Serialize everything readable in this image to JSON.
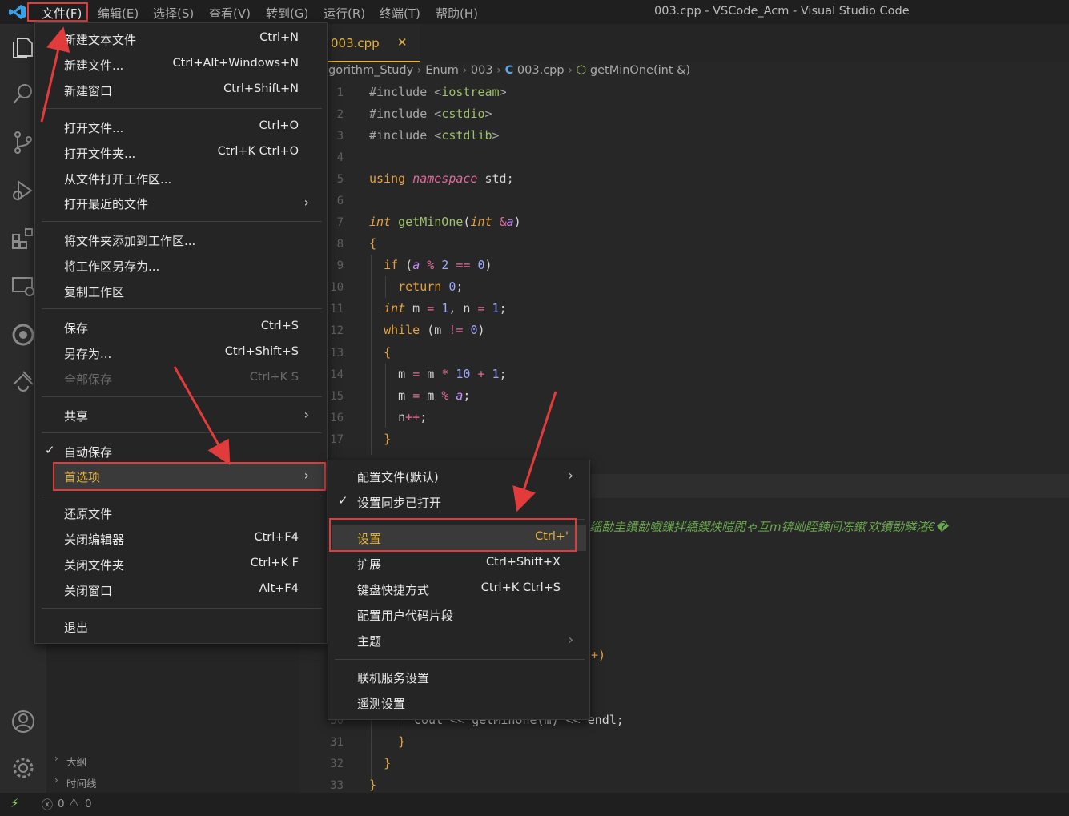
{
  "titlebar": {
    "menus": [
      "文件(F)",
      "编辑(E)",
      "选择(S)",
      "查看(V)",
      "转到(G)",
      "运行(R)",
      "终端(T)",
      "帮助(H)"
    ],
    "window_title": "003.cpp - VSCode_Acm - Visual Studio Code"
  },
  "tab": {
    "filename": "003.cpp",
    "close": "✕"
  },
  "breadcrumb": [
    "gorithm_Study",
    "Enum",
    "003",
    "003.cpp",
    "getMinOne(int &)"
  ],
  "sidebar": {
    "outline": "大纲",
    "timeline": "时间线"
  },
  "status": {
    "errors": "0",
    "warnings": "0"
  },
  "file_menu": {
    "items": [
      {
        "label": "新建文本文件",
        "key": "Ctrl+N"
      },
      {
        "label": "新建文件...",
        "key": "Ctrl+Alt+Windows+N"
      },
      {
        "label": "新建窗口",
        "key": "Ctrl+Shift+N"
      },
      {
        "label": "打开文件...",
        "key": "Ctrl+O"
      },
      {
        "label": "打开文件夹...",
        "key": "Ctrl+K Ctrl+O"
      },
      {
        "label": "从文件打开工作区...",
        "key": ""
      },
      {
        "label": "打开最近的文件",
        "key": ""
      },
      {
        "label": "将文件夹添加到工作区...",
        "key": ""
      },
      {
        "label": "将工作区另存为...",
        "key": ""
      },
      {
        "label": "复制工作区",
        "key": ""
      },
      {
        "label": "保存",
        "key": "Ctrl+S"
      },
      {
        "label": "另存为...",
        "key": "Ctrl+Shift+S"
      },
      {
        "label": "全部保存",
        "key": "Ctrl+K S"
      },
      {
        "label": "共享",
        "key": ""
      },
      {
        "label": "自动保存",
        "key": ""
      },
      {
        "label": "首选项",
        "key": ""
      },
      {
        "label": "还原文件",
        "key": ""
      },
      {
        "label": "关闭编辑器",
        "key": "Ctrl+F4"
      },
      {
        "label": "关闭文件夹",
        "key": "Ctrl+K F"
      },
      {
        "label": "关闭窗口",
        "key": "Alt+F4"
      },
      {
        "label": "退出",
        "key": ""
      }
    ]
  },
  "prefs_menu": {
    "items": [
      {
        "label": "配置文件(默认)",
        "key": ""
      },
      {
        "label": "设置同步已打开",
        "key": ""
      },
      {
        "label": "设置",
        "key": "Ctrl+'"
      },
      {
        "label": "扩展",
        "key": "Ctrl+Shift+X"
      },
      {
        "label": "键盘快捷方式",
        "key": "Ctrl+K Ctrl+S"
      },
      {
        "label": "配置用户代码片段",
        "key": ""
      },
      {
        "label": "主题",
        "key": ""
      },
      {
        "label": "联机服务设置",
        "key": ""
      },
      {
        "label": "遥测设置",
        "key": ""
      }
    ]
  },
  "code": {
    "line_numbers": [
      "1",
      "2",
      "3",
      "4",
      "5",
      "6",
      "7",
      "8",
      "9",
      "10",
      "11",
      "12",
      "13",
      "14",
      "15",
      "16",
      "17",
      "30",
      "31",
      "32",
      "33"
    ],
    "garbled_comment": "缁勫圭鐨勫嚱鏁拌繑鍥炴暟閲ゃ互m锛屾眰鍊间冻鏉′欢鐨勫疄渚€�",
    "partial_paren": "+)",
    "cout_line": "cout << getMinOne(m) << endl;"
  }
}
